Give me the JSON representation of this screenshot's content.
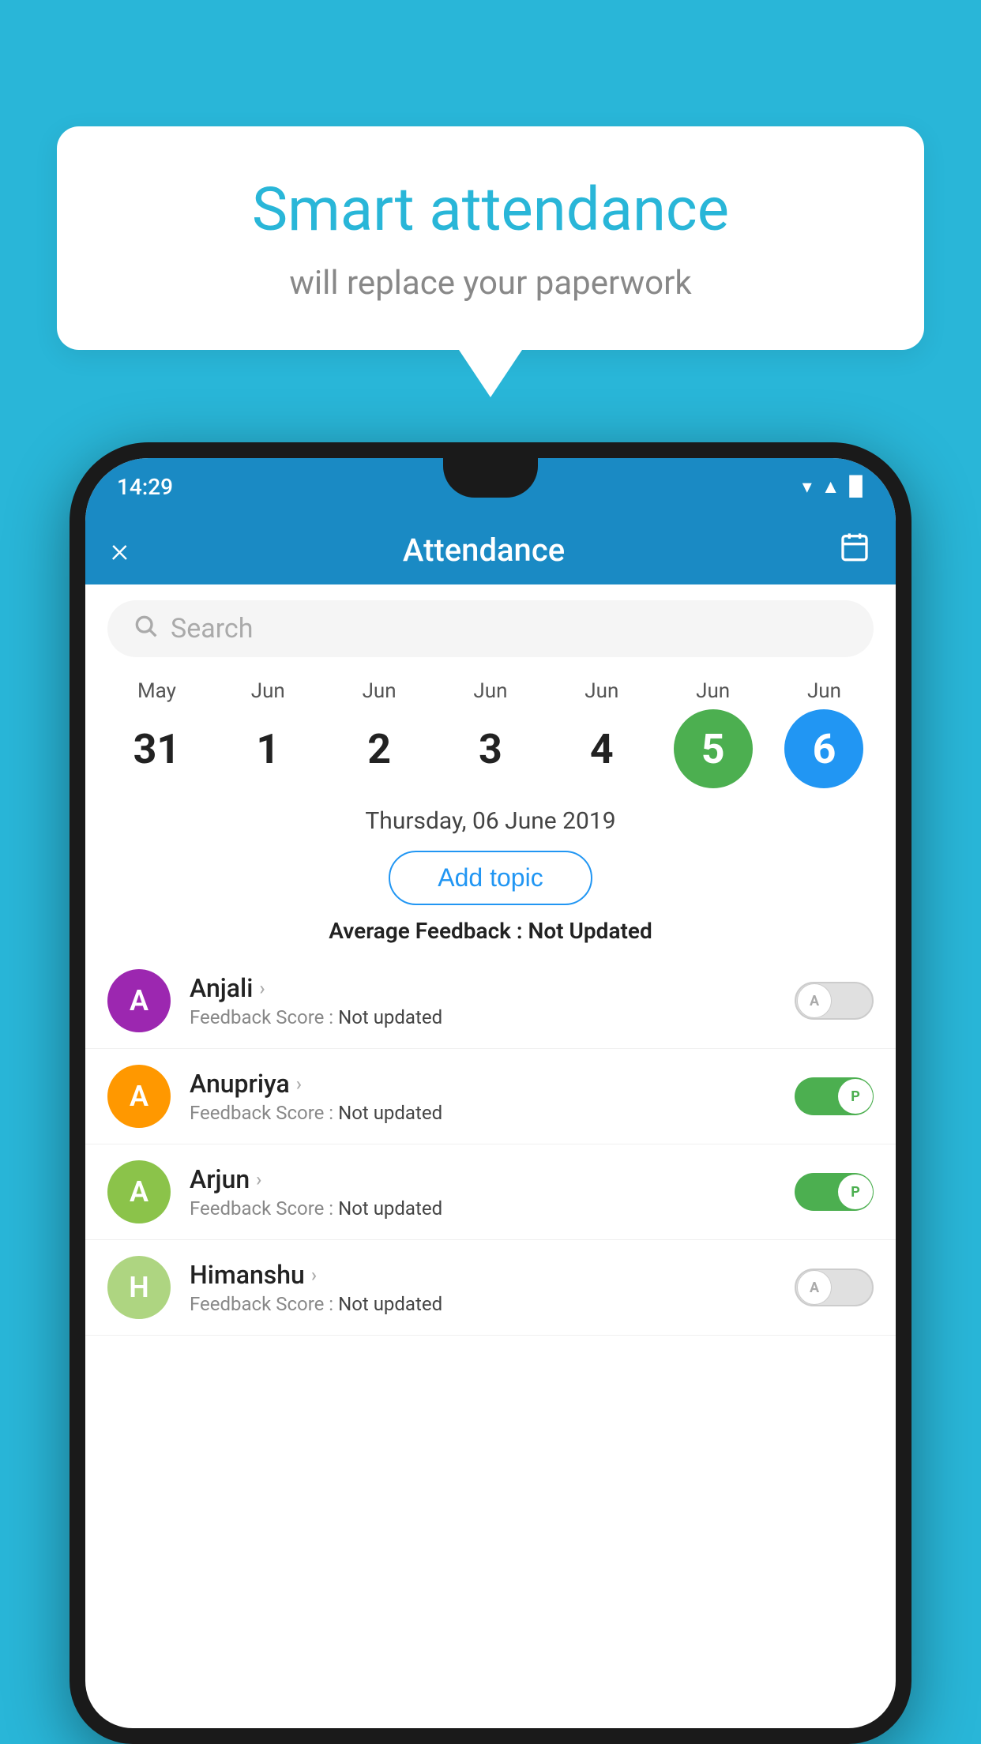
{
  "background": {
    "color": "#29b6d8"
  },
  "speech_bubble": {
    "title": "Smart attendance",
    "subtitle": "will replace your paperwork"
  },
  "phone": {
    "status_bar": {
      "time": "14:29",
      "icons": [
        "wifi",
        "signal",
        "battery"
      ]
    },
    "header": {
      "close_label": "×",
      "title": "Attendance",
      "calendar_icon": "📅"
    },
    "search": {
      "placeholder": "Search"
    },
    "calendar": {
      "days": [
        {
          "month": "May",
          "date": "31",
          "highlight": ""
        },
        {
          "month": "Jun",
          "date": "1",
          "highlight": ""
        },
        {
          "month": "Jun",
          "date": "2",
          "highlight": ""
        },
        {
          "month": "Jun",
          "date": "3",
          "highlight": ""
        },
        {
          "month": "Jun",
          "date": "4",
          "highlight": ""
        },
        {
          "month": "Jun",
          "date": "5",
          "highlight": "green"
        },
        {
          "month": "Jun",
          "date": "6",
          "highlight": "blue"
        }
      ]
    },
    "selected_date": "Thursday, 06 June 2019",
    "add_topic_label": "Add topic",
    "average_feedback": {
      "label": "Average Feedback : ",
      "value": "Not Updated"
    },
    "students": [
      {
        "name": "Anjali",
        "avatar_letter": "A",
        "avatar_class": "avatar-purple",
        "feedback": "Feedback Score : Not updated",
        "attendance": "absent"
      },
      {
        "name": "Anupriya",
        "avatar_letter": "A",
        "avatar_class": "avatar-orange",
        "feedback": "Feedback Score : Not updated",
        "attendance": "present"
      },
      {
        "name": "Arjun",
        "avatar_letter": "A",
        "avatar_class": "avatar-green",
        "feedback": "Feedback Score : Not updated",
        "attendance": "present"
      },
      {
        "name": "Himanshu",
        "avatar_letter": "H",
        "avatar_class": "avatar-lightgreen",
        "feedback": "Feedback Score : Not updated",
        "attendance": "absent"
      }
    ]
  }
}
